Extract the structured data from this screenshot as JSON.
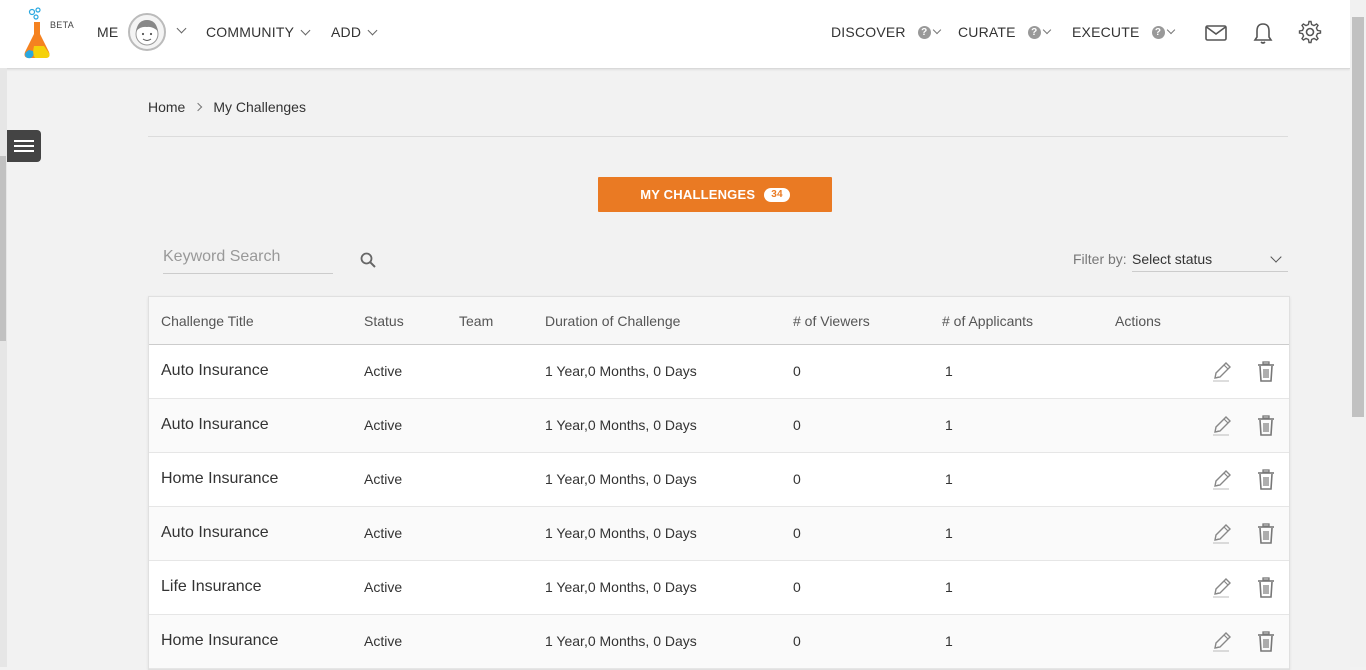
{
  "brand": {
    "beta_label": "BETA"
  },
  "nav": {
    "me": "ME",
    "community": "COMMUNITY",
    "add": "ADD",
    "discover": "DISCOVER",
    "curate": "CURATE",
    "execute": "EXECUTE",
    "help_glyph": "?"
  },
  "icons": {
    "mail": "mail-icon",
    "bell": "bell-icon",
    "settings": "gear-icon",
    "menu": "hamburger-icon",
    "search": "search-icon",
    "edit": "pencil-icon",
    "delete": "trash-icon"
  },
  "colors": {
    "accent": "#ea7a23"
  },
  "breadcrumb": {
    "home": "Home",
    "current": "My Challenges"
  },
  "challenges_button": {
    "label": "MY CHALLENGES",
    "count": "34"
  },
  "search": {
    "placeholder": "Keyword Search",
    "value": ""
  },
  "filter": {
    "label": "Filter by:",
    "selected": "Select status"
  },
  "table": {
    "columns": [
      "Challenge Title",
      "Status",
      "Team",
      "Duration of Challenge",
      "# of Viewers",
      "# of Applicants",
      "Actions"
    ],
    "rows": [
      {
        "title": "Auto Insurance",
        "status": "Active",
        "team": "",
        "duration": "1 Year,0 Months, 0 Days",
        "viewers": "0",
        "applicants": "1"
      },
      {
        "title": "Auto Insurance",
        "status": "Active",
        "team": "",
        "duration": "1 Year,0 Months, 0 Days",
        "viewers": "0",
        "applicants": "1"
      },
      {
        "title": "Home Insurance",
        "status": "Active",
        "team": "",
        "duration": "1 Year,0 Months, 0 Days",
        "viewers": "0",
        "applicants": "1"
      },
      {
        "title": "Auto Insurance",
        "status": "Active",
        "team": "",
        "duration": "1 Year,0 Months, 0 Days",
        "viewers": "0",
        "applicants": "1"
      },
      {
        "title": "Life Insurance",
        "status": "Active",
        "team": "",
        "duration": "1 Year,0 Months, 0 Days",
        "viewers": "0",
        "applicants": "1"
      },
      {
        "title": "Home Insurance",
        "status": "Active",
        "team": "",
        "duration": "1 Year,0 Months, 0 Days",
        "viewers": "0",
        "applicants": "1"
      }
    ]
  }
}
